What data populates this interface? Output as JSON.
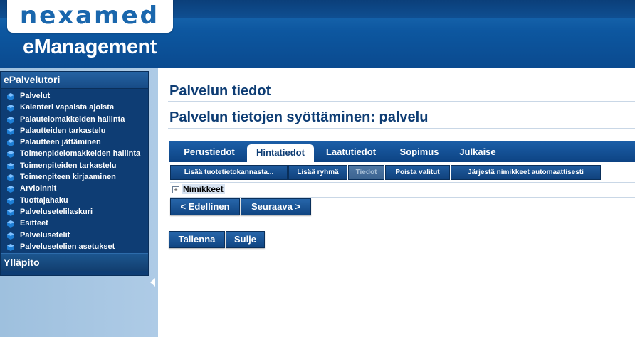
{
  "header": {
    "logo": "nexamed",
    "app_title": "eManagement"
  },
  "sidebar": {
    "section_title": "ePalvelutori",
    "items": [
      {
        "label": "Palvelut"
      },
      {
        "label": "Kalenteri vapaista ajoista"
      },
      {
        "label": "Palautelomakkeiden hallinta"
      },
      {
        "label": "Palautteiden tarkastelu"
      },
      {
        "label": "Palautteen jättäminen"
      },
      {
        "label": "Toimenpidelomakkeiden hallinta"
      },
      {
        "label": "Toimenpiteiden tarkastelu"
      },
      {
        "label": "Toimenpiteen kirjaaminen"
      },
      {
        "label": "Arvioinnit"
      },
      {
        "label": "Tuottajahaku"
      },
      {
        "label": "Palvelusetelilaskuri"
      },
      {
        "label": "Esitteet"
      },
      {
        "label": "Palvelusetelit"
      },
      {
        "label": "Palvelusetelien asetukset"
      }
    ],
    "section2_title": "Ylläpito"
  },
  "main": {
    "title": "Palvelun tiedot",
    "subtitle": "Palvelun tietojen syöttäminen: palvelu",
    "tabs": [
      {
        "label": "Perustiedot",
        "active": false
      },
      {
        "label": "Hintatiedot",
        "active": true
      },
      {
        "label": "Laatutiedot",
        "active": false
      },
      {
        "label": "Sopimus",
        "active": false
      },
      {
        "label": "Julkaise",
        "active": false
      }
    ],
    "subtoolbar": [
      {
        "label": "Lisää tuotetietokannasta..."
      },
      {
        "label": "Lisää ryhmä"
      },
      {
        "label": "Tiedot",
        "disabled": true
      },
      {
        "label": "Poista valitut"
      },
      {
        "label": "Järjestä nimikkeet automaattisesti"
      }
    ],
    "tree": {
      "expand_symbol": "+",
      "node_label": "Nimikkeet"
    },
    "nav_buttons": {
      "prev": "< Edellinen",
      "next": "Seuraava >"
    },
    "actions": {
      "save": "Tallenna",
      "close": "Sulje"
    }
  },
  "colors": {
    "brand": "#0e3d74",
    "header": "#0d57a0"
  }
}
